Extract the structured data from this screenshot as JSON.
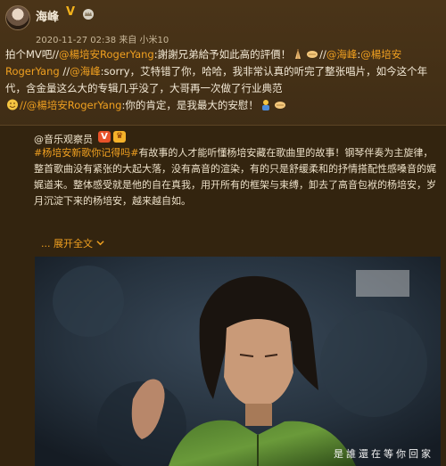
{
  "user": {
    "name": "海峰",
    "verified_mark": "V",
    "timestamp": "2020-11-27 02:38",
    "source": "来自 小米10"
  },
  "post": {
    "seg1": "拍个MV吧//",
    "mention1": "@楊培安RogerYang",
    "seg2": ":謝謝兄弟給予如此高的評價！",
    "seg3": "//",
    "mention2": "@海峰",
    "seg4": ":",
    "mention3": "@楊培安RogerYang",
    "seg5": " //",
    "mention4": "@海峰",
    "seg6": ":sorry，艾特错了你，哈哈，我非常认真的听完了整张唱片，如今这个年代，含金量这么大的专辑几乎没了，大哥再一次做了行业典范",
    "mention5": "//@楊培安RogerYang",
    "seg7": ":你的肯定，是我最大的安慰！"
  },
  "repost": {
    "author": "@音乐观察员",
    "hashtag": "#杨培安新歌你记得吗#",
    "text": "有故事的人才能听懂杨培安藏在歌曲里的故事！钢琴伴奏为主旋律，整首歌曲没有紧张的大起大落，没有高音的渲染，有的只是舒缓柔和的抒情搭配性感嗓音的娓娓道来。整体感受就是他的自在真我，用开所有的框架与束缚，卸去了高音包袱的杨培安，岁月沉淀下来的杨培安，越来越自如。",
    "expand_label": "... 展开全文",
    "expand_icon": "chevron-down-icon",
    "photo_caption": "是誰還在等你回家"
  },
  "colors": {
    "accent": "#f0a020",
    "background": "#3b2a14"
  }
}
